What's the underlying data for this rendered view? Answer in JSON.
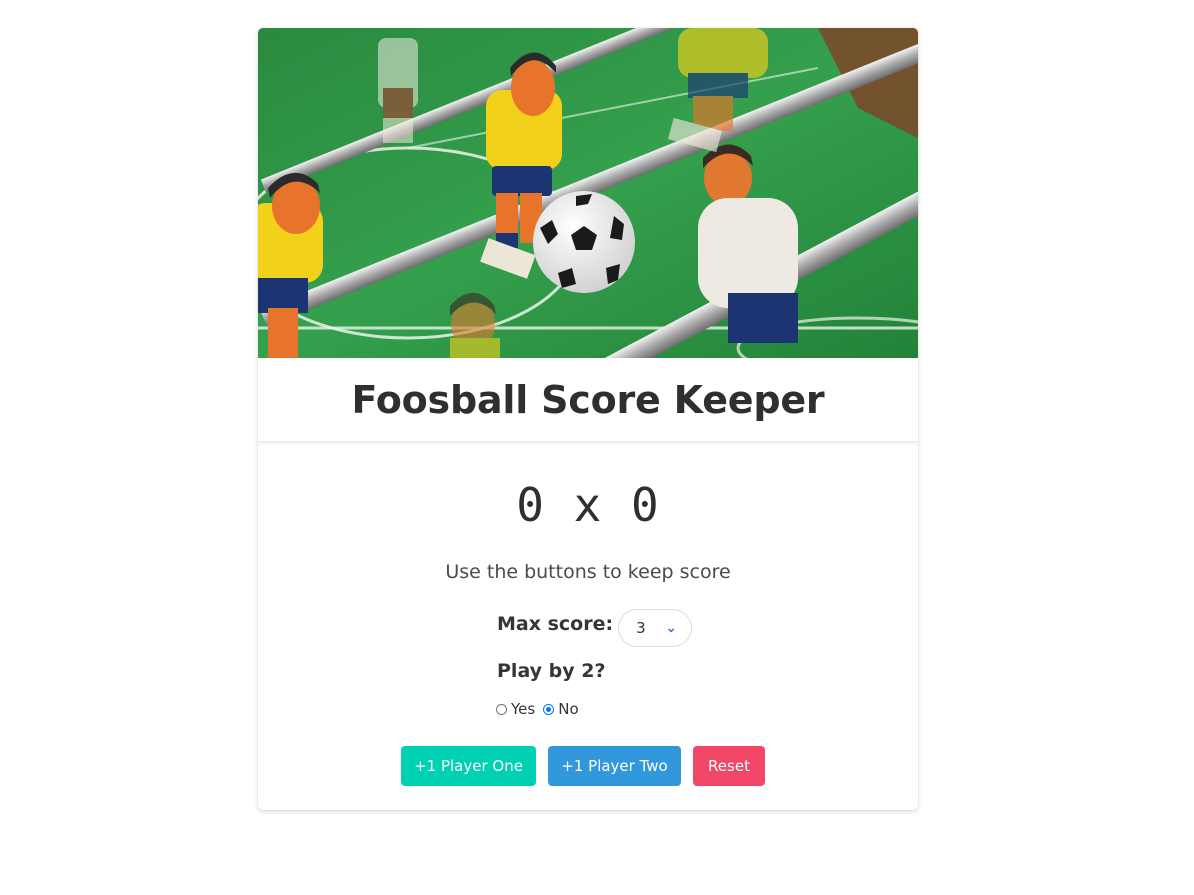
{
  "hero": {
    "alt": "Foosball table with players and a ball"
  },
  "header": {
    "title": "Foosball Score Keeper"
  },
  "score": {
    "p1": "0",
    "separator": "x",
    "p2": "0"
  },
  "hint": "Use the buttons to keep score",
  "max_score": {
    "label": "Max score:",
    "value": "3"
  },
  "play_by_two": {
    "label": "Play by 2?",
    "options": [
      {
        "label": "Yes",
        "checked": false
      },
      {
        "label": "No",
        "checked": true
      }
    ]
  },
  "buttons": {
    "player_one": "+1 Player One",
    "player_two": "+1 Player Two",
    "reset": "Reset"
  },
  "colors": {
    "player_one": "#00d1b2",
    "player_two": "#3298dc",
    "reset": "#f14668",
    "pitch": "#2f9a48"
  }
}
